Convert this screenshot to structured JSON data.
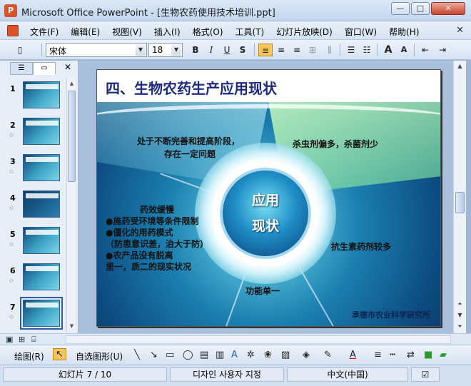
{
  "window": {
    "title": "Microsoft Office PowerPoint - [生物农药使用技术培训.ppt]",
    "buttons": {
      "minimize": "—",
      "maximize": "□",
      "close": "✕"
    }
  },
  "menu": {
    "items": [
      "文件(F)",
      "编辑(E)",
      "视图(V)",
      "插入(I)",
      "格式(O)",
      "工具(T)",
      "幻灯片放映(D)",
      "窗口(W)",
      "帮助(H)"
    ],
    "close_doc": "✕"
  },
  "format_toolbar": {
    "font": "宋体",
    "size": "18",
    "bold": "B",
    "italic": "I",
    "underline": "U",
    "shadow": "S",
    "grow_font": "A",
    "shrink_font": "A"
  },
  "left_panel": {
    "close": "✕",
    "slides": [
      {
        "num": "1"
      },
      {
        "num": "2"
      },
      {
        "num": "3"
      },
      {
        "num": "4"
      },
      {
        "num": "5"
      },
      {
        "num": "6"
      },
      {
        "num": "7"
      }
    ]
  },
  "slide": {
    "title": "四、生物农药生产应用现状",
    "core": [
      "应用",
      "现状"
    ],
    "top_left": [
      "处于不断完善和提高阶段，",
      "存在一定问题"
    ],
    "top_right": "杀虫剂偏多，杀菌剂少",
    "left_block": [
      "药效缓慢",
      "●施药受环境等条件限制",
      "●僵化的用药模式",
      "（防患意识差，治大于防）",
      "●农产品没有脱离",
      "里一，质二的现实状况"
    ],
    "right": "抗生素药剂较多",
    "bottom": "功能单一",
    "footer": "承德市农业科学研究所"
  },
  "draw_toolbar": {
    "draw_label": "绘图(R)",
    "autoshape_label": "自选图形(U)"
  },
  "status": {
    "slide_position": "幻灯片 7 / 10",
    "design": "디자인 사용자 지정",
    "language": "中文(中国)"
  }
}
